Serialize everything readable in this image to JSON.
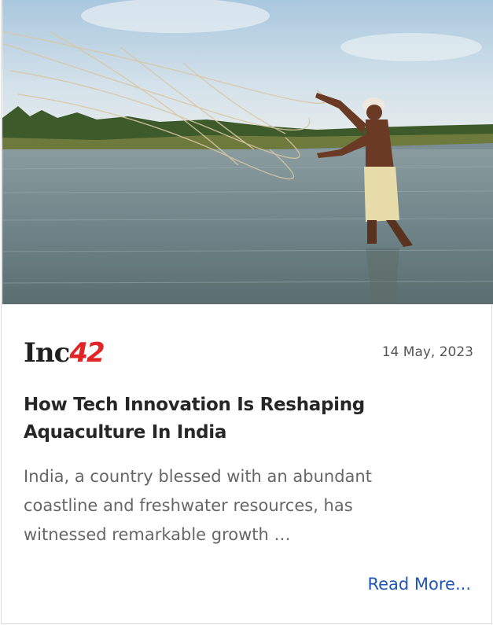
{
  "article": {
    "image_alt": "Fisherman casting a net into water",
    "source_logo": {
      "text": "Inc",
      "number": "42"
    },
    "date": "14 May, 2023",
    "title_line1": "How Tech Innovation Is Reshaping",
    "title_line2": "Aquaculture In India",
    "excerpt_line1": "India, a country blessed with an abundant",
    "excerpt_line2": "coastline and freshwater resources, has",
    "excerpt_line3": "witnessed remarkable growth …",
    "read_more_label": "Read More..."
  },
  "colors": {
    "logo_accent": "#e32426",
    "link": "#1f56b4",
    "title": "#262626",
    "body_text": "#666666"
  }
}
